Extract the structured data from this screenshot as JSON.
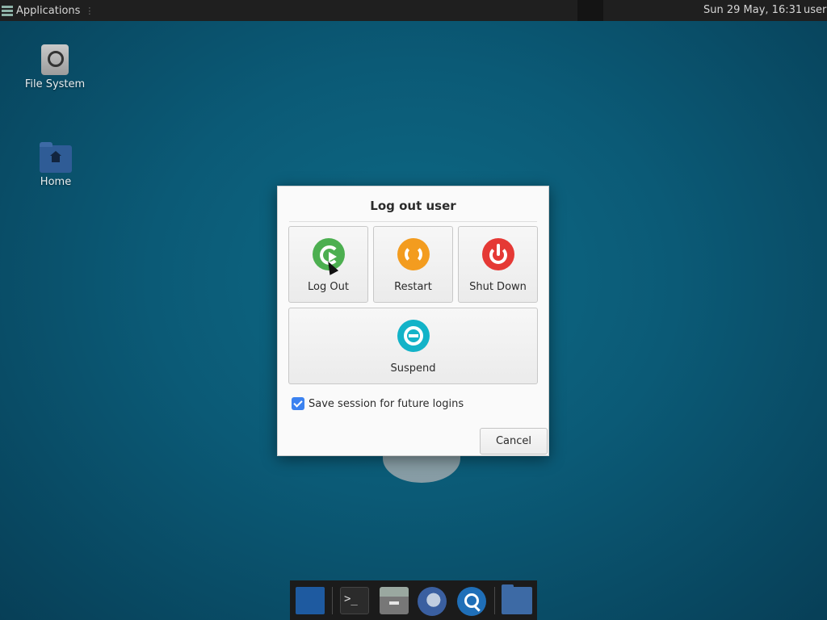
{
  "top_panel": {
    "applications_label": "Applications",
    "clock": "Sun 29 May, 16:31",
    "user": "user"
  },
  "desktop": {
    "icons": [
      {
        "label": "File System",
        "icon": "drive-icon"
      },
      {
        "label": "Home",
        "icon": "home-folder-icon"
      }
    ]
  },
  "dialog": {
    "title": "Log out user",
    "actions": {
      "logout": "Log Out",
      "restart": "Restart",
      "shutdown": "Shut Down",
      "suspend": "Suspend"
    },
    "save_session": {
      "label": "Save session for future logins",
      "checked": true
    },
    "cancel_label": "Cancel",
    "colors": {
      "logout": "#4caf50",
      "restart": "#f39c1f",
      "shutdown": "#e53935",
      "suspend": "#13b3c8"
    }
  },
  "dock": {
    "items": [
      "desktop-icon",
      "terminal-icon",
      "file-manager-icon",
      "web-browser-icon",
      "app-finder-icon",
      "folder-icon"
    ],
    "terminal_glyph": ">_"
  }
}
